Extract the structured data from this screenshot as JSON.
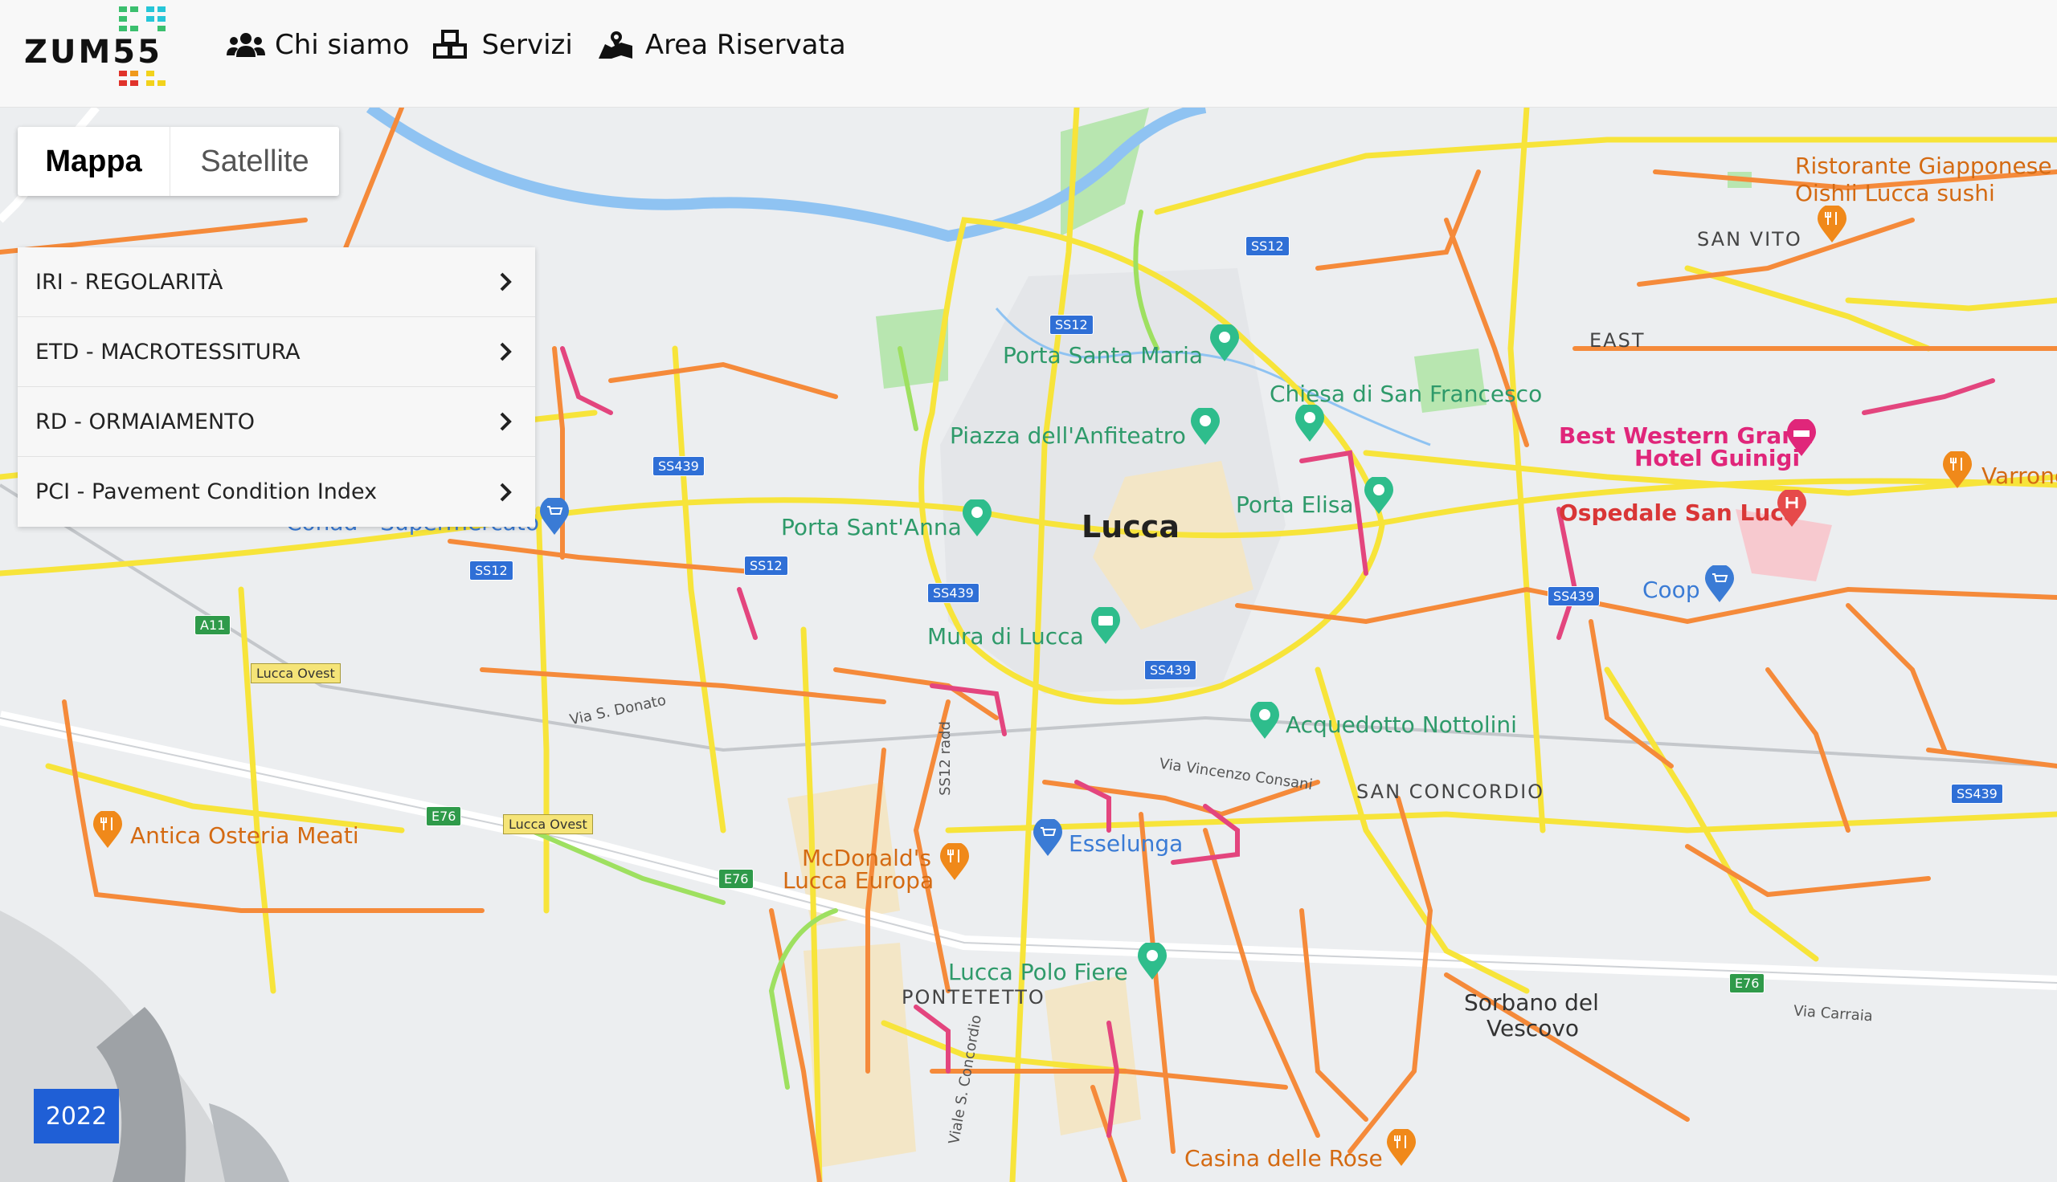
{
  "header": {
    "logo_text": "ZUM55",
    "nav": [
      {
        "label": "Chi siamo",
        "icon": "users-icon"
      },
      {
        "label": "Servizi",
        "icon": "boxes-icon"
      },
      {
        "label": "Area Riservata",
        "icon": "map-marked-icon"
      }
    ]
  },
  "map_type": {
    "active": "Mappa",
    "inactive": "Satellite"
  },
  "layers": [
    {
      "label": "IRI - REGOLARITÀ"
    },
    {
      "label": "ETD - MACROTESSITURA"
    },
    {
      "label": "RD - ORMAIAMENTO"
    },
    {
      "label": "PCI - Pavement Condition Index"
    }
  ],
  "year_badge": "2022",
  "colors": {
    "road_yellow": "#f7e43a",
    "road_orange": "#f58a3a",
    "road_magenta": "#e3457e",
    "road_green": "#9ee060",
    "river": "#8fc3f2",
    "park": "#b8e6b0",
    "accent_blue": "#1f5fd6"
  },
  "map": {
    "places": [
      {
        "name": "Lucca",
        "kind": "city"
      },
      {
        "name": "Porta Santa Maria",
        "kind": "landmark"
      },
      {
        "name": "Chiesa di San Francesco",
        "kind": "landmark"
      },
      {
        "name": "Piazza dell'Anfiteatro",
        "kind": "landmark"
      },
      {
        "name": "Porta Elisa",
        "kind": "landmark"
      },
      {
        "name": "Porta Sant'Anna",
        "kind": "landmark"
      },
      {
        "name": "Mura di Lucca",
        "kind": "landmark"
      },
      {
        "name": "Acquedotto Nottolini",
        "kind": "landmark"
      },
      {
        "name": "Lucca Polo Fiere",
        "kind": "landmark"
      },
      {
        "name": "Conad - Supermercato",
        "kind": "shop"
      },
      {
        "name": "Esselunga",
        "kind": "shop"
      },
      {
        "name": "Coop",
        "kind": "shop"
      },
      {
        "name": "Best Western Grand",
        "kind": "hotel"
      },
      {
        "name": "Hotel Guinigi",
        "kind": "hotel"
      },
      {
        "name": "Ospedale San Luca",
        "kind": "hospital"
      },
      {
        "name": "Ristorante Giapponese",
        "kind": "food"
      },
      {
        "name": "Oishii Lucca sushi",
        "kind": "food"
      },
      {
        "name": "Varrone",
        "kind": "food"
      },
      {
        "name": "McDonald's",
        "kind": "food"
      },
      {
        "name": "Lucca Europa",
        "kind": "food"
      },
      {
        "name": "Antica Osteria Meati",
        "kind": "food"
      },
      {
        "name": "Casina delle Rose",
        "kind": "food"
      },
      {
        "name": "SAN VITO",
        "kind": "area"
      },
      {
        "name": "EAST",
        "kind": "area"
      },
      {
        "name": "SAN CONCORDIO",
        "kind": "area"
      },
      {
        "name": "PONTETETTO",
        "kind": "area"
      },
      {
        "name": "Sorbano del",
        "kind": "area"
      },
      {
        "name": "Vescovo",
        "kind": "area"
      }
    ],
    "roads": {
      "via_s_donato": "Via S. Donato",
      "via_vincenzo_consani": "Via Vincenzo Consani",
      "via_carraia": "Via Carraia",
      "via_di_concordia": "Viale S. Concordio",
      "ss12_radd": "SS12 radd"
    },
    "shields": [
      "SS12",
      "SS12",
      "SS439",
      "SS12",
      "SS12",
      "SS439",
      "SS439",
      "SS439",
      "SS439",
      "A11",
      "E76",
      "E76",
      "E76",
      "Lucca Ovest",
      "Lucca Ovest"
    ]
  }
}
